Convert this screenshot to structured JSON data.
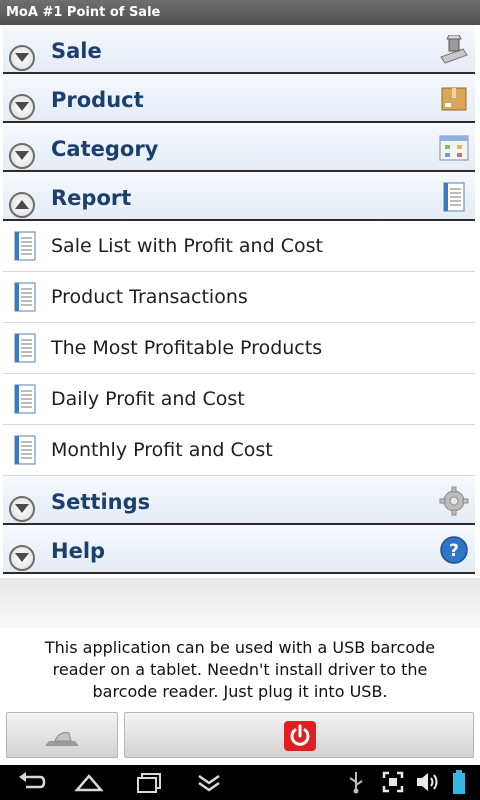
{
  "app": {
    "title": "MoA #1 Point of Sale"
  },
  "categories": {
    "sale": "Sale",
    "product": "Product",
    "category": "Category",
    "report": "Report",
    "settings": "Settings",
    "help": "Help"
  },
  "report_items": [
    "Sale List with Profit and Cost",
    "Product Transactions",
    "The Most Profitable Products",
    "Daily Profit and Cost",
    "Monthly Profit and Cost"
  ],
  "info": {
    "line1": "This application can be used with a USB barcode",
    "line2": "reader on a tablet. Needn't install driver to the",
    "line3": "barcode reader. Just plug it into USB."
  },
  "colors": {
    "accent": "#1b3f6e",
    "power": "#e02020"
  }
}
